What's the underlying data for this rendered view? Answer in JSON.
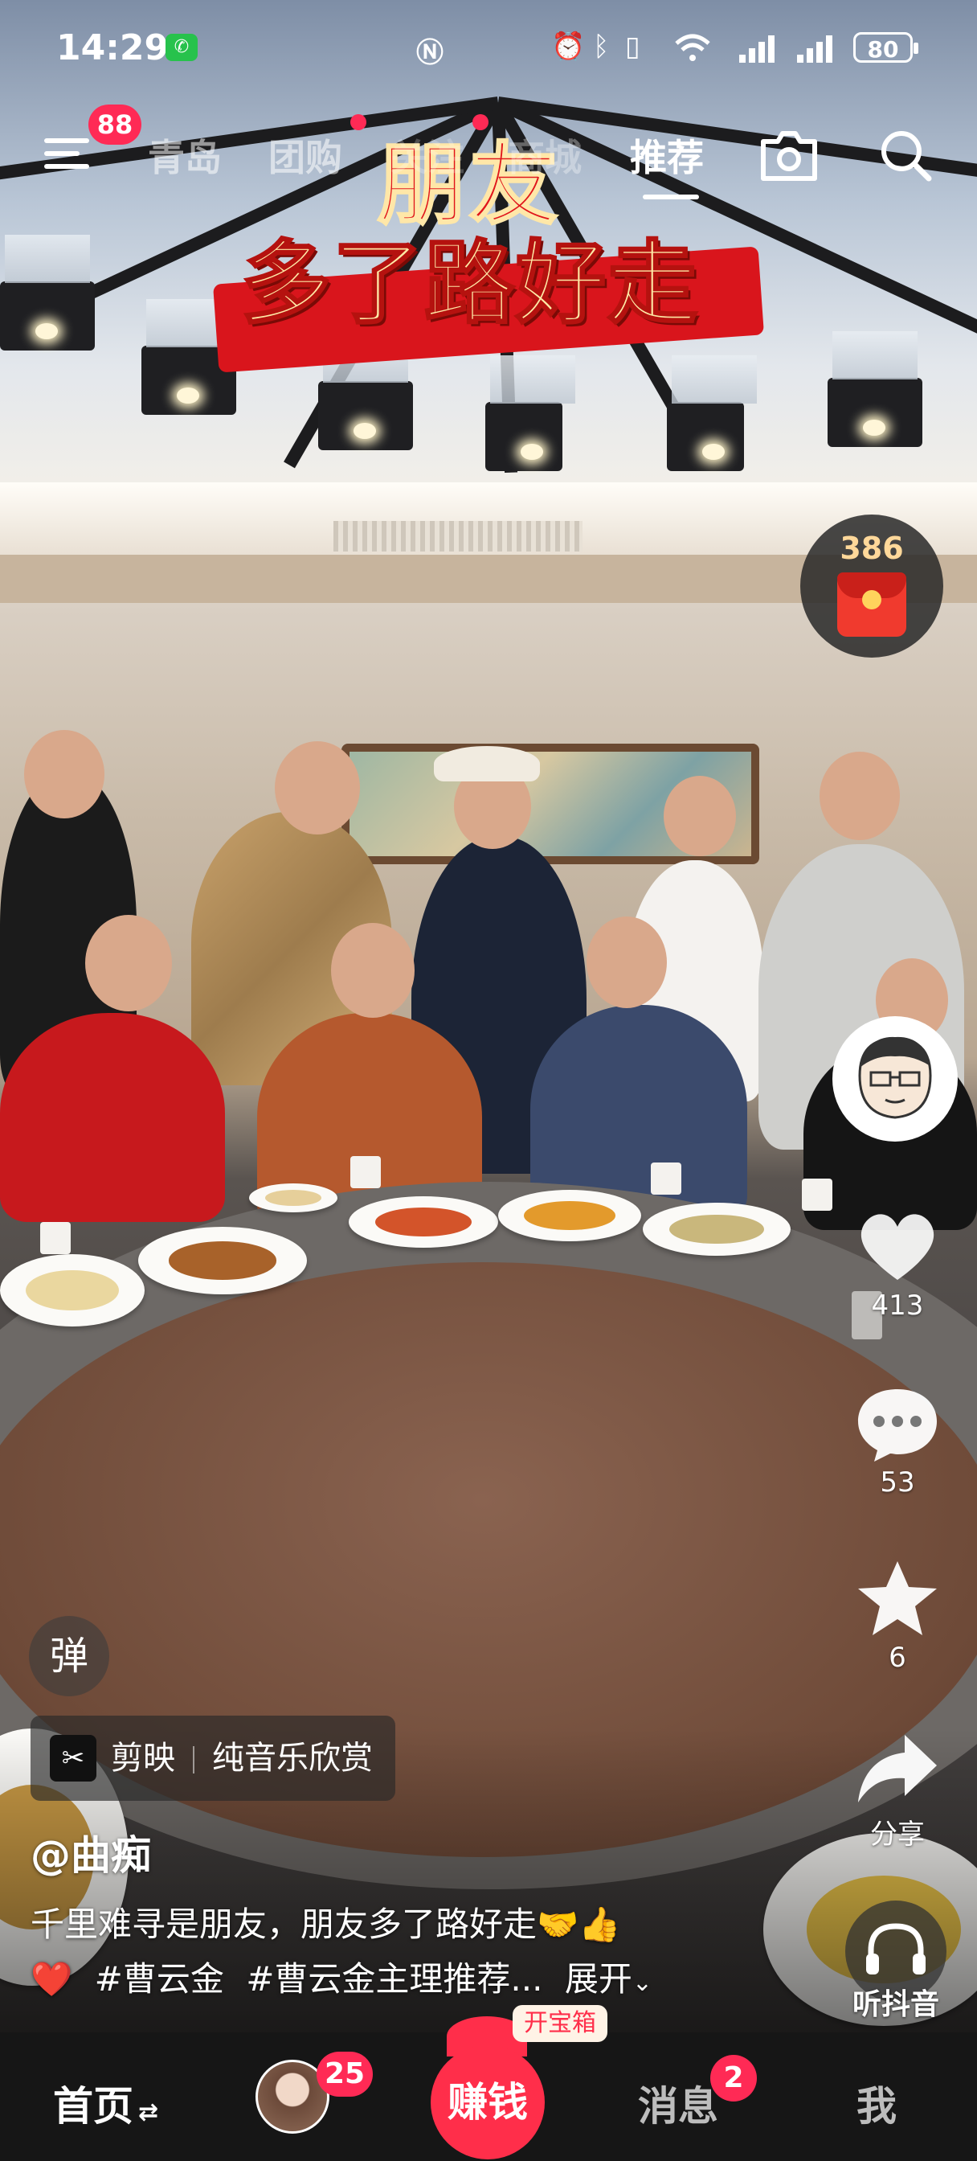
{
  "status_bar": {
    "time": "14:29",
    "battery": "80",
    "icons": [
      "wechat-icon",
      "nfc-icon",
      "alarm-icon",
      "bluetooth-icon",
      "vibrate-icon",
      "wifi-icon",
      "signal-icon",
      "signal-icon",
      "battery-icon"
    ]
  },
  "top_nav": {
    "menu_badge": "88",
    "tabs": [
      {
        "label": "青岛",
        "active": false
      },
      {
        "label": "团购",
        "active": false
      },
      {
        "label": "关注",
        "active": false
      },
      {
        "label": "商城",
        "active": false
      },
      {
        "label": "推荐",
        "active": true
      }
    ],
    "icons": [
      "menu-icon",
      "camera-icon",
      "search-icon"
    ]
  },
  "video": {
    "title_line1": "朋友",
    "title_line2": "多了路好走"
  },
  "red_packet": {
    "count": "386"
  },
  "actions": {
    "like_count": "413",
    "comment_count": "53",
    "favorite_count": "6",
    "share_label": "分享"
  },
  "info": {
    "danmu_label": "弹",
    "capcut_app": "剪映",
    "capcut_tag": "纯音乐欣赏",
    "author": "@曲痴",
    "description": "千里难寻是朋友，朋友多了路好走🤝👍",
    "hashtags": [
      "#曹云金",
      "#曹云金主理推荐..."
    ],
    "heart_emoji": "❤️",
    "expand_label": "展开",
    "listen_label": "听抖音"
  },
  "bottom_bar": {
    "home_label": "首页",
    "friends_badge": "25",
    "earn_label": "赚钱",
    "treasure_label": "开宝箱",
    "messages_label": "消息",
    "messages_badge": "2",
    "me_label": "我"
  },
  "colors": {
    "accent": "#ff2a55",
    "banner_red": "#d9151c",
    "banner_gold": "#ffe9a6"
  }
}
